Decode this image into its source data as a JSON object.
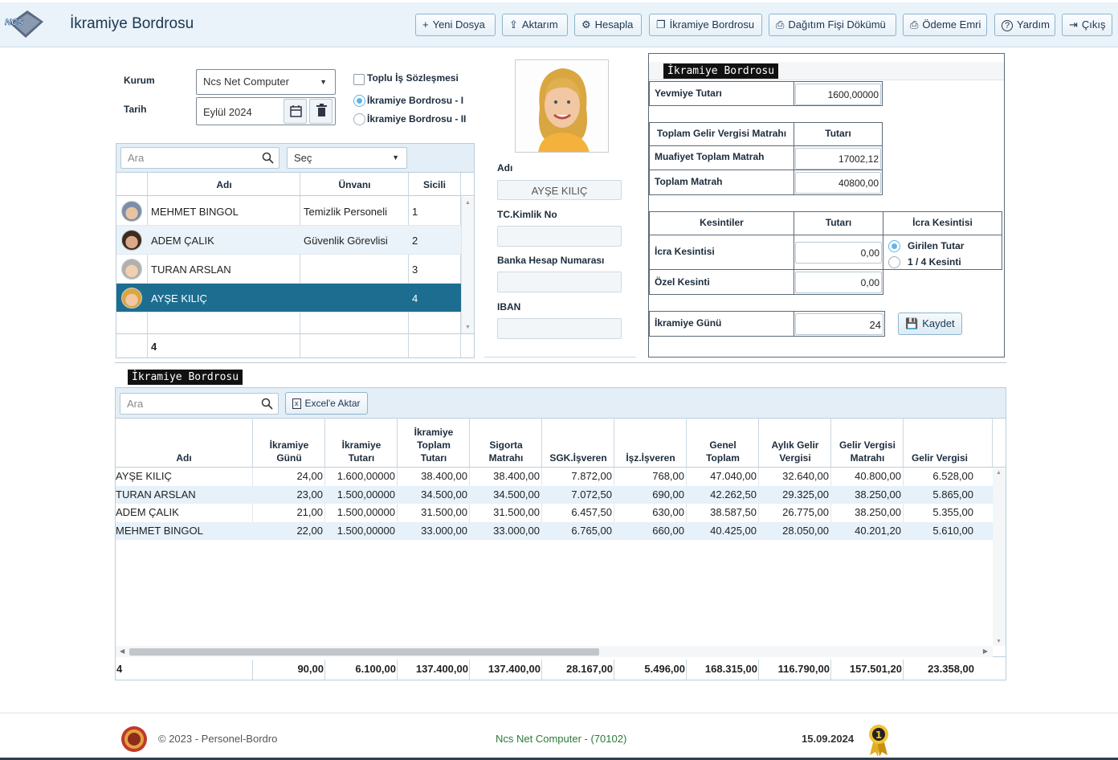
{
  "header": {
    "title": "İkramiye Bordrosu",
    "toolbar": [
      {
        "label": "Yeni Dosya",
        "icon": "plus-icon"
      },
      {
        "label": "Aktarım",
        "icon": "export-icon"
      },
      {
        "label": "Hesapla",
        "icon": "gear-icon"
      },
      {
        "label": "İkramiye Bordrosu",
        "icon": "documents-icon"
      },
      {
        "label": "Dağıtım Fişi Dökümü",
        "icon": "print-icon"
      },
      {
        "label": "Ödeme Emri",
        "icon": "print-icon"
      },
      {
        "label": "Yardım",
        "icon": "help-icon"
      },
      {
        "label": "Çıkış",
        "icon": "logout-icon"
      }
    ]
  },
  "filter": {
    "kurum_label": "Kurum",
    "kurum_value": "Ncs Net Computer",
    "tarih_label": "Tarih",
    "tarih_value": "Eylül 2024",
    "toplu_label": "Toplu İş Sözleşmesi",
    "radio1": "İkramiye Bordrosu - I",
    "radio2": "İkramiye Bordrosu - II"
  },
  "staff": {
    "search_placeholder": "Ara",
    "select_placeholder": "Seç",
    "columns": [
      "Adı",
      "Ünvanı",
      "Sicili"
    ],
    "rows": [
      {
        "name": "MEHMET BINGOL",
        "title": "Temizlik Personeli",
        "id": "1"
      },
      {
        "name": "ADEM ÇALIK",
        "title": "Güvenlik Görevlisi",
        "id": "2"
      },
      {
        "name": "TURAN ARSLAN",
        "title": "",
        "id": "3"
      },
      {
        "name": "AYŞE KILIÇ",
        "title": "",
        "id": "4"
      }
    ],
    "count": "4"
  },
  "detail": {
    "name_label": "Adı",
    "name_value": "AYŞE KILIÇ",
    "tc_label": "TC.Kimlik No",
    "bank_label": "Banka Hesap Numarası",
    "iban_label": "IBAN"
  },
  "bordro": {
    "badge": "İkramiye Bordrosu",
    "yevmiye_label": "Yevmiye Tutarı",
    "yevmiye_value": "1600,00000",
    "matrah_header": "Toplam Gelir Vergisi Matrahı",
    "tutar_header": "Tutarı",
    "muafiyet_label": "Muafiyet Toplam Matrah",
    "muafiyet_value": "17002,12",
    "toplam_label": "Toplam Matrah",
    "toplam_value": "40800,00",
    "kesintiler_header": "Kesintiler",
    "icra_header": "İcra Kesintisi",
    "icra_label": "İcra Kesintisi",
    "icra_value": "0,00",
    "ozel_label": "Özel Kesinti",
    "ozel_value": "0,00",
    "opt1": "Girilen Tutar",
    "opt2": "1 / 4 Kesinti",
    "gun_label": "İkramiye Günü",
    "gun_value": "24",
    "save_label": "Kaydet"
  },
  "results": {
    "badge": "İkramiye Bordrosu",
    "search_placeholder": "Ara",
    "excel_label": "Excel'e Aktar",
    "columns": [
      [
        "Adı"
      ],
      [
        "İkramiye",
        "Günü"
      ],
      [
        "İkramiye",
        "Tutarı"
      ],
      [
        "İkramiye",
        "Toplam",
        "Tutarı"
      ],
      [
        "Sigorta",
        "Matrahı"
      ],
      [
        "SGK.İşveren"
      ],
      [
        "İşz.İşveren"
      ],
      [
        "Genel",
        "Toplam"
      ],
      [
        "Aylık Gelir",
        "Vergisi"
      ],
      [
        "Gelir Vergisi",
        "Matrahı"
      ],
      [
        "Gelir Vergisi"
      ]
    ],
    "rows": [
      [
        "AYŞE KILIÇ",
        "24,00",
        "1.600,00000",
        "38.400,00",
        "38.400,00",
        "7.872,00",
        "768,00",
        "47.040,00",
        "32.640,00",
        "40.800,00",
        "6.528,00"
      ],
      [
        "TURAN ARSLAN",
        "23,00",
        "1.500,00000",
        "34.500,00",
        "34.500,00",
        "7.072,50",
        "690,00",
        "42.262,50",
        "29.325,00",
        "38.250,00",
        "5.865,00"
      ],
      [
        "ADEM ÇALIK",
        "21,00",
        "1.500,00000",
        "31.500,00",
        "31.500,00",
        "6.457,50",
        "630,00",
        "38.587,50",
        "26.775,00",
        "38.250,00",
        "5.355,00"
      ],
      [
        "MEHMET BINGOL",
        "22,00",
        "1.500,00000",
        "33.000,00",
        "33.000,00",
        "6.765,00",
        "660,00",
        "40.425,00",
        "28.050,00",
        "40.201,20",
        "5.610,00"
      ]
    ],
    "totals": [
      "4",
      "90,00",
      "6.100,00",
      "137.400,00",
      "137.400,00",
      "28.167,00",
      "5.496,00",
      "168.315,00",
      "116.790,00",
      "157.501,20",
      "23.358,00"
    ]
  },
  "footer": {
    "copyright": "© 2023 - Personel-Bordro",
    "company": "Ncs Net Computer - (70102)",
    "date": "15.09.2024"
  }
}
